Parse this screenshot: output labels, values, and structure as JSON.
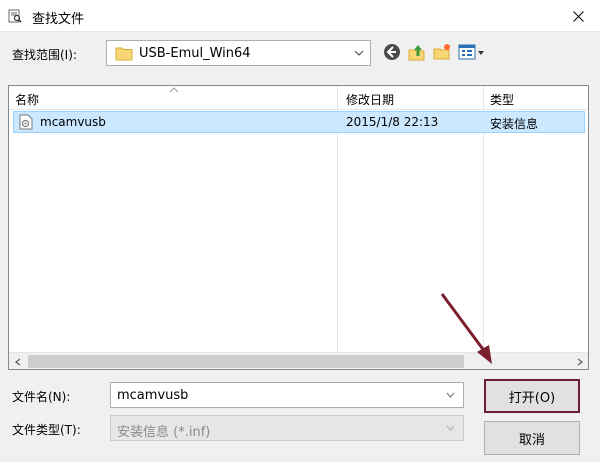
{
  "window": {
    "title": "查找文件"
  },
  "toolbar": {
    "look_in_label": "查找范围(I):",
    "look_in_value": "USB-Emul_Win64"
  },
  "file_list": {
    "columns": [
      "名称",
      "修改日期",
      "类型"
    ],
    "rows": [
      {
        "name": "mcamvusb",
        "modified": "2015/1/8 22:13",
        "type": "安装信息"
      }
    ]
  },
  "footer": {
    "filename_label": "文件名(N):",
    "filename_value": "mcamvusb",
    "filetype_label": "文件类型(T):",
    "filetype_value": "安装信息 (*.inf)",
    "open_label": "打开(O)",
    "cancel_label": "取消"
  },
  "colors": {
    "selection": "#cce8ff",
    "highlight_border": "#6b1f2f",
    "arrow": "#7a1e2c"
  }
}
